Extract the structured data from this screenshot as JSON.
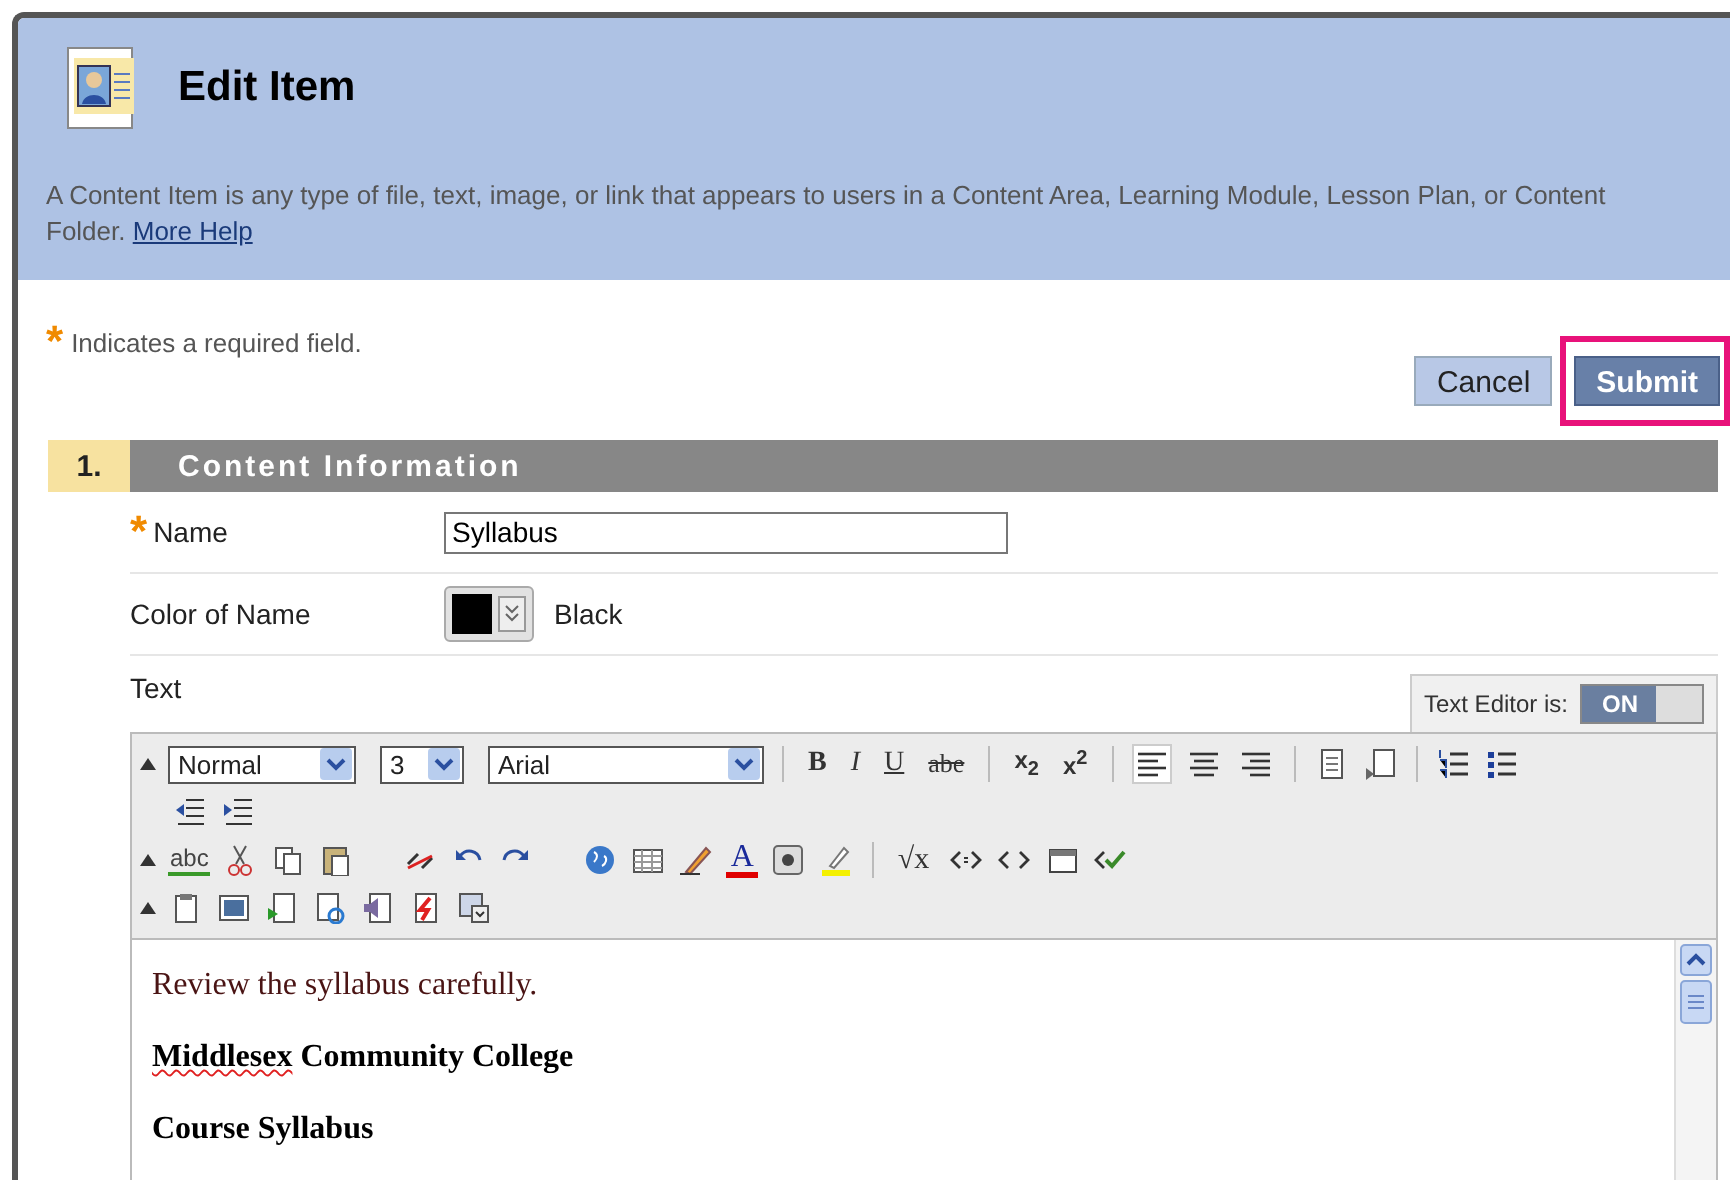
{
  "header": {
    "title": "Edit Item",
    "description": "A Content Item is any type of file, text, image, or link that appears to users in a Content Area, Learning Module, Lesson Plan, or Content Folder.",
    "help_link": "More Help"
  },
  "required_note": {
    "mark": "*",
    "text": "Indicates a required field."
  },
  "buttons": [
    {
      "label": "Cancel",
      "kind": "secondary",
      "highlighted": false
    },
    {
      "label": "Submit",
      "kind": "primary",
      "highlighted": true
    }
  ],
  "section": {
    "number": "1.",
    "title": "Content Information"
  },
  "fields": [
    {
      "kind": "text",
      "label": "Name",
      "required": true,
      "required_mark": "*",
      "value": "Syllabus"
    },
    {
      "kind": "color",
      "label": "Color of Name",
      "color": "#000000",
      "value": "Black"
    },
    {
      "kind": "editor",
      "label": "Text"
    }
  ],
  "editor": {
    "toggle_label": "Text Editor is:",
    "toggle_text": "ON",
    "on": true,
    "format": "Normal",
    "size": "3",
    "font": "Arial",
    "style_buttons": [
      {
        "kind": "bold",
        "label": "B"
      },
      {
        "kind": "italic",
        "label": "I"
      },
      {
        "kind": "underline",
        "label": "U"
      },
      {
        "kind": "strike",
        "label": "abe"
      }
    ],
    "script_buttons": [
      "x$_{2}$",
      "x$^{2}$"
    ],
    "alignments": [
      {
        "kind": "left",
        "selected": true
      },
      {
        "kind": "center",
        "selected": false
      },
      {
        "kind": "right",
        "selected": false
      }
    ],
    "spell_label": "abc",
    "font_color_label": "A",
    "formula_label": "√x",
    "content": [
      {
        "kind": "plain",
        "segments": [
          {
            "text": "Review the syllabus carefully.",
            "misspelled": false
          }
        ]
      },
      {
        "kind": "heading",
        "segments": [
          {
            "text": "Middlesex",
            "misspelled": true
          },
          {
            "text": " Community College",
            "misspelled": false
          }
        ]
      },
      {
        "kind": "heading",
        "segments": [
          {
            "text": "Course Syllabus",
            "misspelled": false
          }
        ]
      }
    ]
  }
}
